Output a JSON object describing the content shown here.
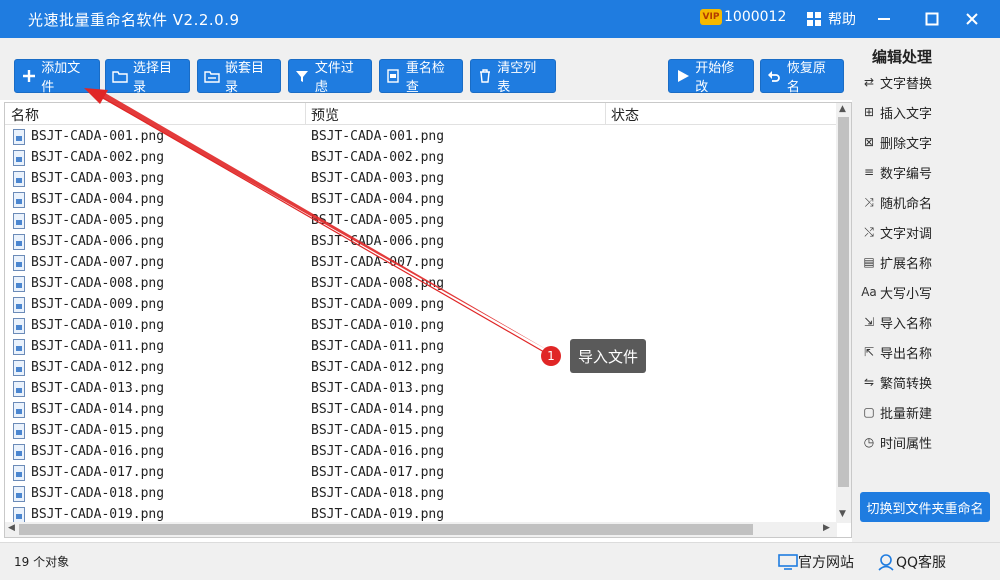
{
  "window": {
    "title": "光速批量重命名软件 V2.2.0.9",
    "vip_badge": "VIP",
    "user_id": "1000012",
    "help_label": "帮助",
    "accent_color": "#1f7ce0"
  },
  "toolbar": {
    "add_files": "添加文件",
    "select_dir": "选择目录",
    "nested_dir": "嵌套目录",
    "file_filter": "文件过虑",
    "dup_check": "重名检查",
    "clear_list": "清空列表",
    "start_modify": "开始修改",
    "restore_name": "恢复原名"
  },
  "file_list": {
    "headers": {
      "name": "名称",
      "preview": "预览",
      "status": "状态"
    },
    "rows": [
      {
        "name": "BSJT-CADA-001.png",
        "preview": "BSJT-CADA-001.png"
      },
      {
        "name": "BSJT-CADA-002.png",
        "preview": "BSJT-CADA-002.png"
      },
      {
        "name": "BSJT-CADA-003.png",
        "preview": "BSJT-CADA-003.png"
      },
      {
        "name": "BSJT-CADA-004.png",
        "preview": "BSJT-CADA-004.png"
      },
      {
        "name": "BSJT-CADA-005.png",
        "preview": "BSJT-CADA-005.png"
      },
      {
        "name": "BSJT-CADA-006.png",
        "preview": "BSJT-CADA-006.png"
      },
      {
        "name": "BSJT-CADA-007.png",
        "preview": "BSJT-CADA-007.png"
      },
      {
        "name": "BSJT-CADA-008.png",
        "preview": "BSJT-CADA-008.png"
      },
      {
        "name": "BSJT-CADA-009.png",
        "preview": "BSJT-CADA-009.png"
      },
      {
        "name": "BSJT-CADA-010.png",
        "preview": "BSJT-CADA-010.png"
      },
      {
        "name": "BSJT-CADA-011.png",
        "preview": "BSJT-CADA-011.png"
      },
      {
        "name": "BSJT-CADA-012.png",
        "preview": "BSJT-CADA-012.png"
      },
      {
        "name": "BSJT-CADA-013.png",
        "preview": "BSJT-CADA-013.png"
      },
      {
        "name": "BSJT-CADA-014.png",
        "preview": "BSJT-CADA-014.png"
      },
      {
        "name": "BSJT-CADA-015.png",
        "preview": "BSJT-CADA-015.png"
      },
      {
        "name": "BSJT-CADA-016.png",
        "preview": "BSJT-CADA-016.png"
      },
      {
        "name": "BSJT-CADA-017.png",
        "preview": "BSJT-CADA-017.png"
      },
      {
        "name": "BSJT-CADA-018.png",
        "preview": "BSJT-CADA-018.png"
      },
      {
        "name": "BSJT-CADA-019.png",
        "preview": "BSJT-CADA-019.png"
      }
    ]
  },
  "sidebar": {
    "title": "编辑处理",
    "items": [
      {
        "label": "文字替换",
        "icon": "replace-icon"
      },
      {
        "label": "插入文字",
        "icon": "insert-icon"
      },
      {
        "label": "删除文字",
        "icon": "delete-text-icon"
      },
      {
        "label": "数字编号",
        "icon": "number-icon"
      },
      {
        "label": "随机命名",
        "icon": "shuffle-icon"
      },
      {
        "label": "文字对调",
        "icon": "swap-icon"
      },
      {
        "label": "扩展名称",
        "icon": "extension-icon"
      },
      {
        "label": "大写小写",
        "icon": "case-icon"
      },
      {
        "label": "导入名称",
        "icon": "import-icon"
      },
      {
        "label": "导出名称",
        "icon": "export-icon"
      },
      {
        "label": "繁简转换",
        "icon": "convert-icon"
      },
      {
        "label": "批量新建",
        "icon": "new-icon"
      },
      {
        "label": "时间属性",
        "icon": "clock-icon"
      }
    ],
    "switch_label": "切换到文件夹重命名"
  },
  "status": {
    "count": "19 个对象",
    "official_site": "官方网站",
    "qq_service": "QQ客服"
  },
  "annotation": {
    "step": "1",
    "label": "导入文件"
  }
}
